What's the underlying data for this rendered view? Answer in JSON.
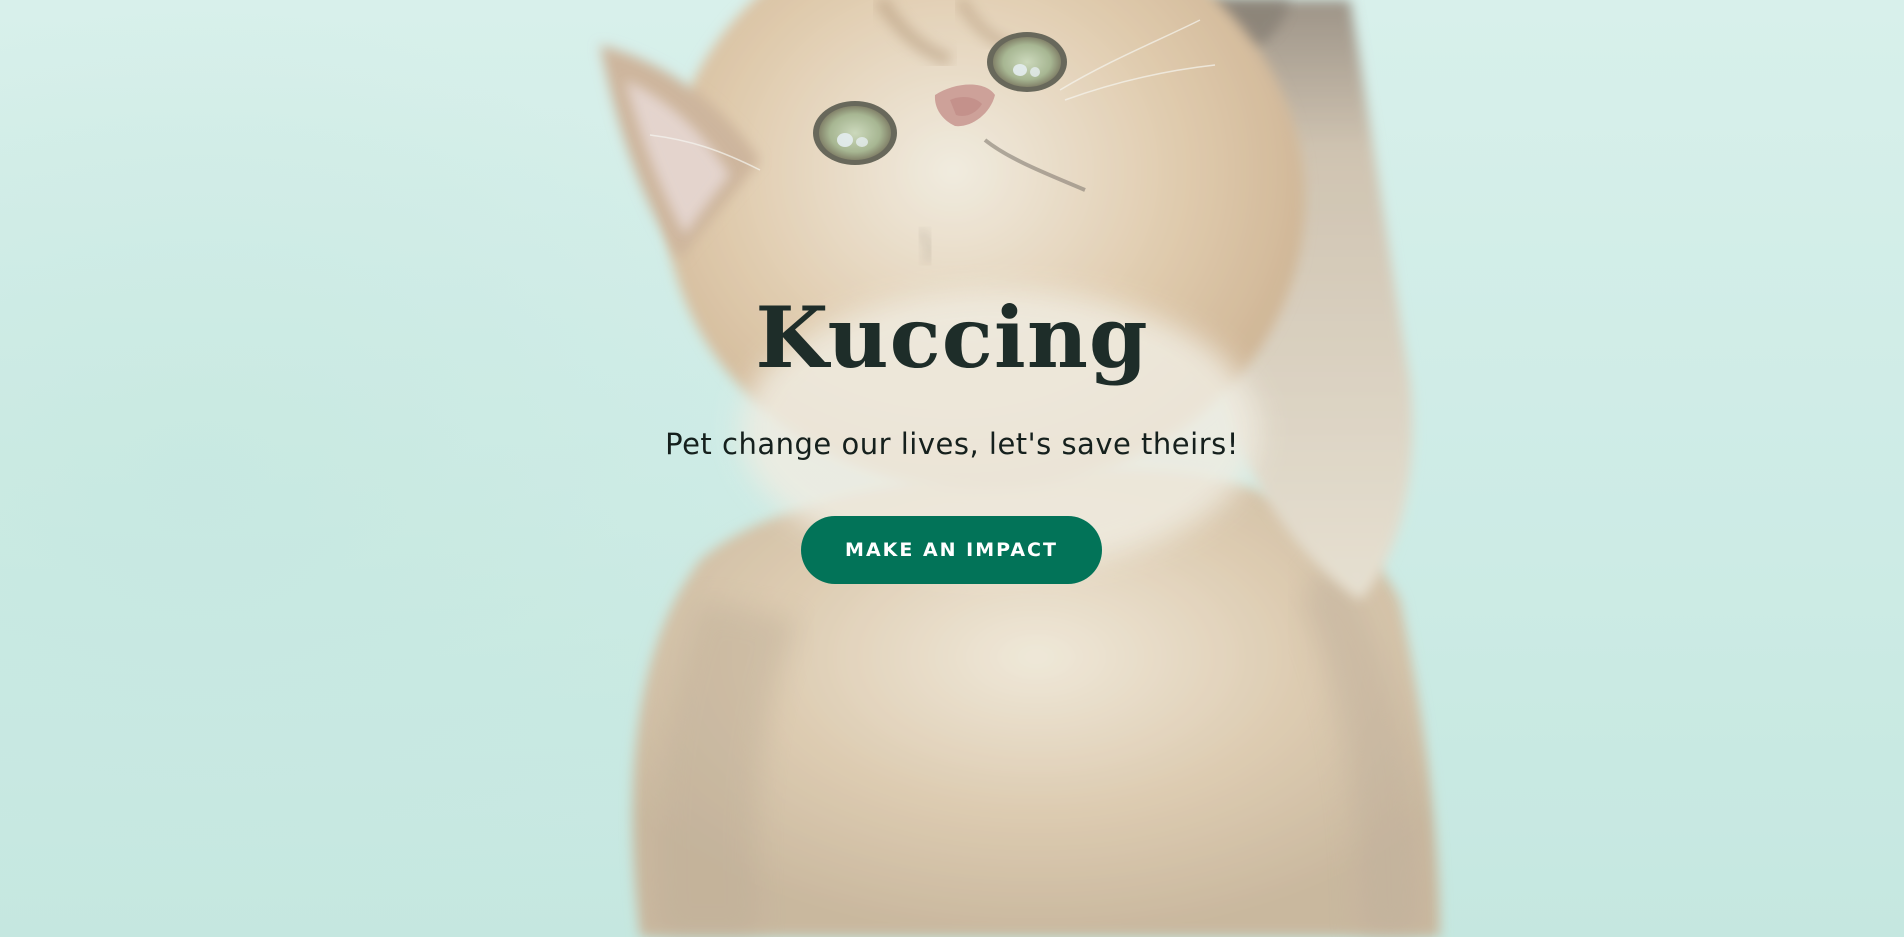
{
  "hero": {
    "title": "Kuccing",
    "subtitle": "Pet change our lives, let's save theirs!",
    "cta_label": "MAKE AN IMPACT",
    "background_image": "kitten-photo"
  },
  "colors": {
    "background": "#cdebe5",
    "title": "#1e2d29",
    "subtitle": "#15201d",
    "button": "#027358",
    "button_text": "#ffffff"
  }
}
